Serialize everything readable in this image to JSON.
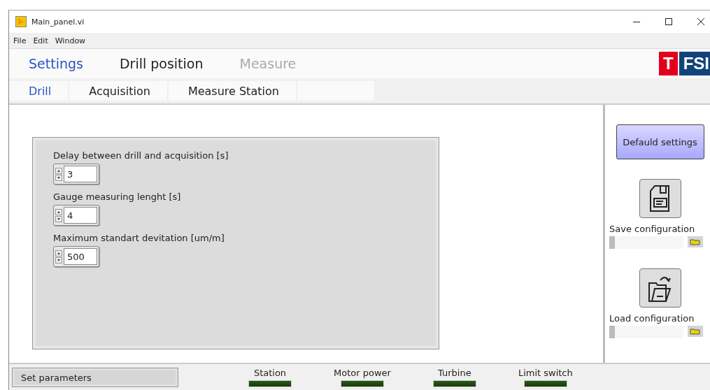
{
  "window": {
    "title": "Main_panel.vi"
  },
  "menu": [
    "File",
    "Edit",
    "Window"
  ],
  "tabs": [
    {
      "label": "Settings",
      "selected": true,
      "disabled": false
    },
    {
      "label": "Drill position",
      "selected": false,
      "disabled": false
    },
    {
      "label": "Measure",
      "selected": false,
      "disabled": true
    }
  ],
  "logo": {
    "letter": "T",
    "text": "FSI"
  },
  "subtabs": [
    {
      "label": "Drill",
      "selected": true
    },
    {
      "label": "Acquisition",
      "selected": false
    },
    {
      "label": "Measure Station",
      "selected": false
    }
  ],
  "parameters": [
    {
      "label": "Delay between drill and acquisition [s]",
      "value": "3"
    },
    {
      "label": "Gauge measuring lenght [s]",
      "value": "4"
    },
    {
      "label": "Maximum standart devitation [um/m]",
      "value": "500"
    }
  ],
  "side": {
    "default_button": "Defauld settings",
    "save_label": "Save configuration",
    "load_label": "Load configuration"
  },
  "status": "Set parameters",
  "indicators": [
    {
      "label": "Station",
      "on": false
    },
    {
      "label": "Motor power",
      "on": false
    },
    {
      "label": "Turbine",
      "on": false
    },
    {
      "label": "Limit switch",
      "on": false
    }
  ]
}
